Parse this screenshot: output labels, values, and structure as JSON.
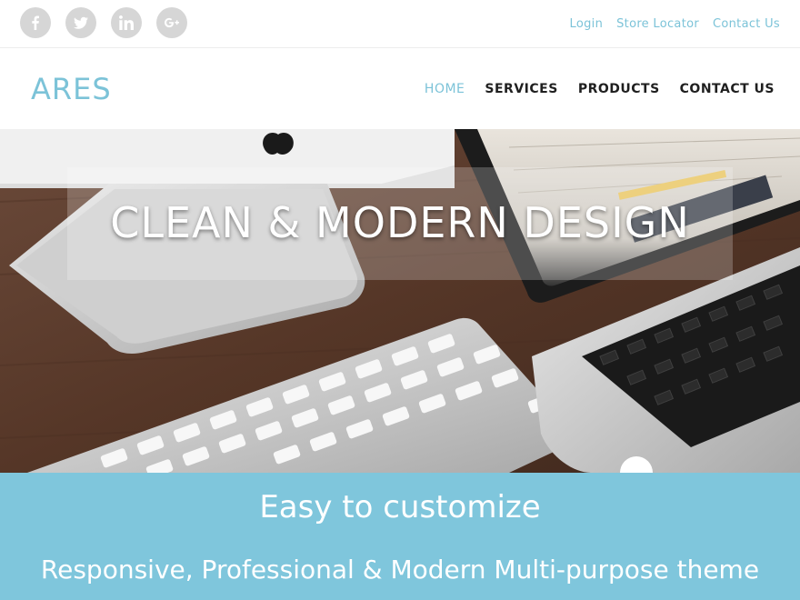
{
  "top_bar": {
    "social": [
      {
        "icon": "facebook-icon"
      },
      {
        "icon": "twitter-icon"
      },
      {
        "icon": "linkedin-icon"
      },
      {
        "icon": "google-plus-icon"
      }
    ],
    "links": [
      "Login",
      "Store Locator",
      "Contact Us"
    ]
  },
  "header": {
    "logo": "ARES",
    "nav": [
      "HOME",
      "SERVICES",
      "PRODUCTS",
      "CONTACT US"
    ],
    "active_nav": "HOME"
  },
  "hero": {
    "title": "CLEAN & MODERN DESIGN"
  },
  "band": {
    "title": "Easy to customize",
    "subtitle": "Responsive, Professional & Modern Multi-purpose theme"
  },
  "colors": {
    "accent": "#7cc3d8",
    "band": "#7fc6dc",
    "social_button": "#d6d6d6",
    "nav_text": "#1f1f1f"
  }
}
